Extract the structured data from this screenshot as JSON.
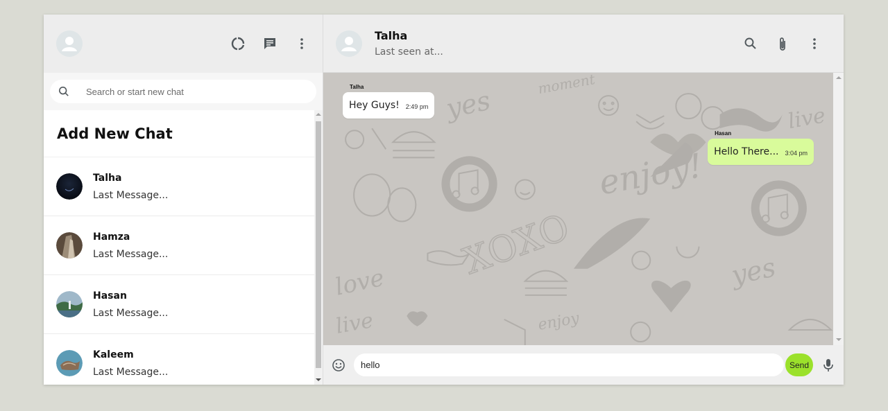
{
  "sidebar": {
    "search_placeholder": "Search or start new chat",
    "add_new_chat": "Add New Chat",
    "chats": [
      {
        "name": "Talha",
        "last_message": "Last Message..."
      },
      {
        "name": "Hamza",
        "last_message": "Last Message..."
      },
      {
        "name": "Hasan",
        "last_message": "Last Message..."
      },
      {
        "name": "Kaleem",
        "last_message": "Last Message..."
      }
    ],
    "icons": [
      "status-icon",
      "new-chat-icon",
      "more-vertical-icon"
    ]
  },
  "chat": {
    "name": "Talha",
    "status": "Last seen at...",
    "icons": [
      "search-icon",
      "attachment-icon",
      "more-vertical-icon"
    ],
    "messages": [
      {
        "sender": "Talha",
        "text": "Hey Guys!",
        "time": "2:49 pm",
        "direction": "received"
      },
      {
        "sender": "Hasan",
        "text": "Hello There...",
        "time": "3:04 pm",
        "direction": "sent"
      }
    ]
  },
  "composer": {
    "value": "hello",
    "send_label": "Send"
  },
  "colors": {
    "page_bg": "#dadbd3",
    "header_bg": "#ededed",
    "chat_bg": "#c9c6c2",
    "sent_bubble": "#d9fb9b",
    "send_button": "#9be12b"
  }
}
